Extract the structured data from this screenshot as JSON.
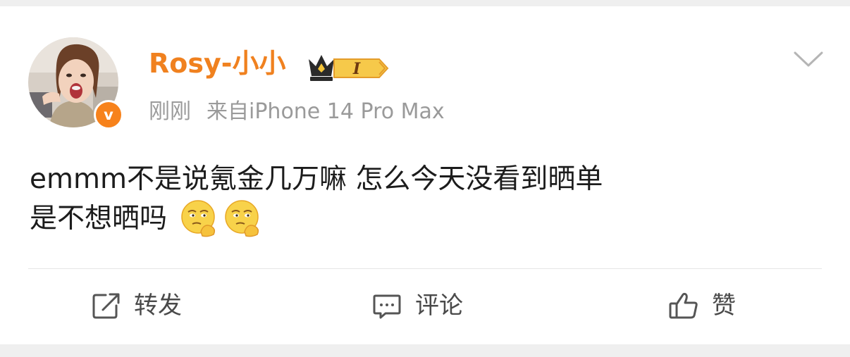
{
  "post": {
    "username": "Rosy-小小",
    "member_level": "I",
    "time": "刚刚",
    "source": "来自iPhone 14 Pro Max",
    "text_line1": "emmm不是说氪金几万嘛 怎么今天没看到晒单",
    "text_line2": "是不想晒吗"
  },
  "emoji": [
    "doubt-thinking-emoji",
    "doubt-thinking-emoji"
  ],
  "actions": {
    "repost_label": "转发",
    "comment_label": "评论",
    "like_label": "赞"
  },
  "colors": {
    "username": "#f0811f",
    "verified_badge": "#f7821b",
    "meta_text": "#9a9a9a",
    "body_text": "#1c1c1c",
    "action_text": "#4a4a4a",
    "background": "#efefef"
  },
  "icons": {
    "verified": "verified-v-badge",
    "member": "crown-icon",
    "menu": "chevron-down-icon",
    "repost": "share-square-icon",
    "comment": "comment-bubble-icon",
    "like": "thumbs-up-icon"
  }
}
